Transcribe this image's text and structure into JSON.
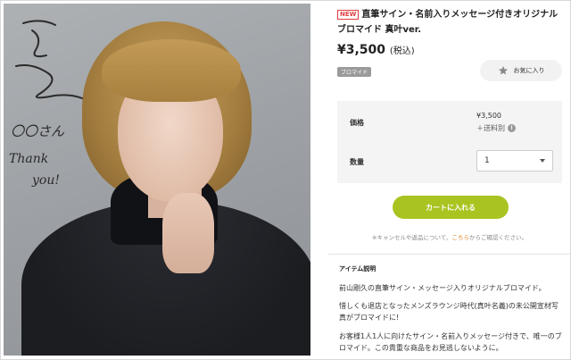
{
  "product": {
    "new_badge": "NEW",
    "title": "直筆サイン・名前入りメッセージ付きオリジナルブロマイド 真叶ver.",
    "price": "¥3,500",
    "tax_note": "(税込)",
    "category_tag": "ブロマイド",
    "favorite_label": "お気に入り"
  },
  "photo": {
    "signature_line1": "〇〇さん",
    "signature_line2": "Thank",
    "signature_line3": "you!"
  },
  "spec": {
    "price_label": "価格",
    "price_value": "¥3,500",
    "shipping": "＋送料別",
    "quantity_label": "数量",
    "quantity_value": "1"
  },
  "cart": {
    "button_label": "カートに入れる",
    "note_prefix": "※キャンセルや返品について、",
    "note_link": "こちら",
    "note_suffix": "からご確認ください。"
  },
  "description": {
    "heading": "アイテム説明",
    "para1": "前山剛久の直筆サイン・メッセージ入りオリジナルブロマイド。",
    "para2": "惜しくも退店となったメンズラウンジ時代(真叶名義)の未公開宣材写真がブロマイドに!",
    "para3": "お客様1人1人に向けたサイン・名前入りメッセージ付きで、唯一のブロマイド。この貴重な商品をお見逃しないように。"
  },
  "colors": {
    "accent_green": "#a9c421",
    "new_red": "#e03c3c",
    "link_orange": "#e08a2e"
  },
  "icons": {
    "favorite": "star-icon",
    "info": "info-icon",
    "dropdown": "chevron-down-icon"
  }
}
